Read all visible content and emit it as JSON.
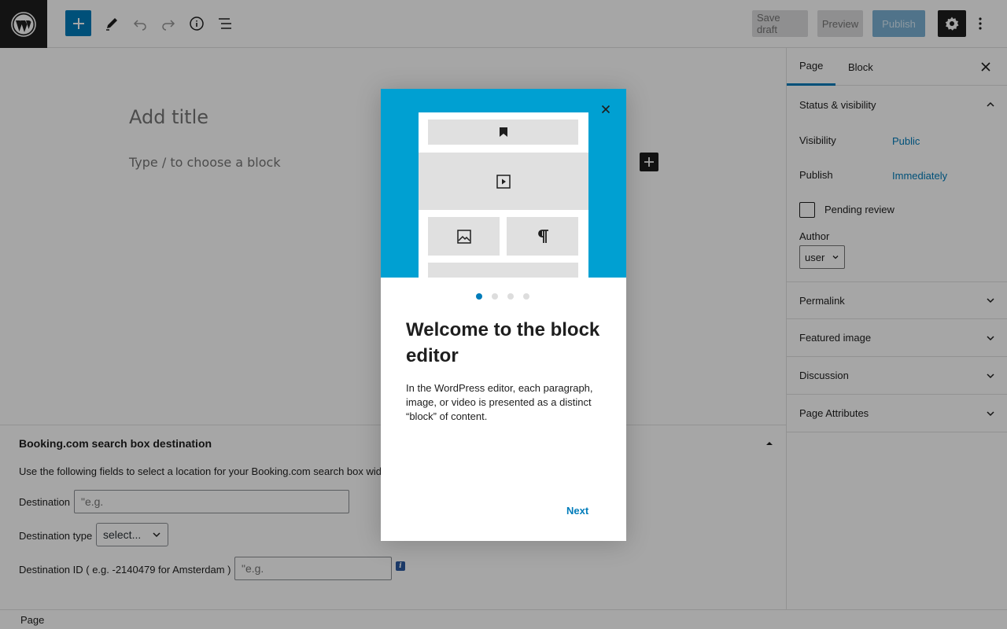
{
  "topbar": {
    "logo_icon": "wordpress-icon",
    "add_icon": "plus-icon",
    "edit_icon": "pencil-icon",
    "undo_icon": "undo-icon",
    "redo_icon": "redo-icon",
    "info_icon": "info-icon",
    "list_icon": "list-view-icon",
    "save_draft": "Save draft",
    "preview": "Preview",
    "publish": "Publish",
    "settings_icon": "gear-icon",
    "more_icon": "more-vertical-icon"
  },
  "editor": {
    "title_placeholder": "Add title",
    "block_placeholder": "Type / to choose a block"
  },
  "metabox": {
    "title": "Booking.com search box destination",
    "description": "Use the following fields to select a location for your Booking.com search box wid",
    "destination_label": "Destination",
    "destination_placeholder": "\"e.g.",
    "destination_type_label": "Destination type",
    "destination_type_value": "select...",
    "destination_id_label": "Destination ID ( e.g. -2140479 for Amsterdam )",
    "destination_id_placeholder": "\"e.g."
  },
  "footer": {
    "breadcrumb": "Page"
  },
  "sidebar": {
    "tabs": [
      "Page",
      "Block"
    ],
    "status_visibility": "Status & visibility",
    "visibility_label": "Visibility",
    "visibility_value": "Public",
    "publish_label": "Publish",
    "publish_value": "Immediately",
    "pending_review": "Pending review",
    "author_label": "Author",
    "author_value": "user",
    "panels": [
      "Permalink",
      "Featured image",
      "Discussion",
      "Page Attributes"
    ]
  },
  "modal": {
    "heading": "Welcome to the block editor",
    "body": "In the WordPress editor, each paragraph, image, or video is presented as a distinct “block” of content.",
    "next": "Next",
    "page_count": 4,
    "current_page": 1
  },
  "colors": {
    "accent": "#007cba",
    "hero": "#00a0d2"
  }
}
